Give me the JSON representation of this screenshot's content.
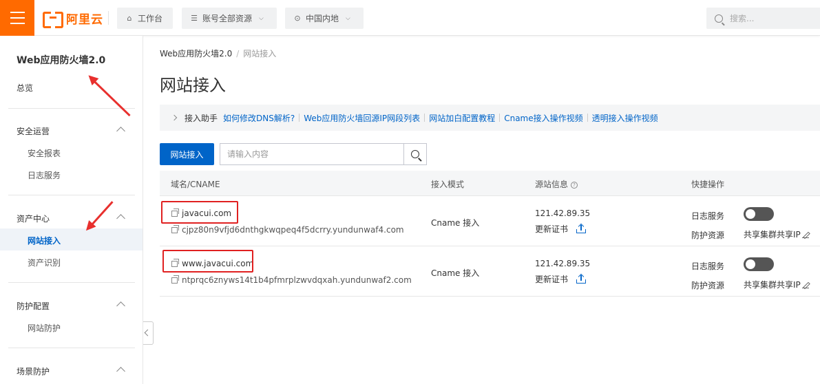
{
  "topbar": {
    "logo_text": "阿里云",
    "workbench": "工作台",
    "account_resources": "账号全部资源",
    "region": "中国内地",
    "search_placeholder": "搜索..."
  },
  "sidebar": {
    "title": "Web应用防火墙2.0",
    "overview": "总览",
    "groups": [
      {
        "label": "安全运营",
        "items": [
          "安全报表",
          "日志服务"
        ]
      },
      {
        "label": "资产中心",
        "items": [
          "网站接入",
          "资产识别"
        ]
      },
      {
        "label": "防护配置",
        "items": [
          "网站防护"
        ]
      },
      {
        "label": "场景防护",
        "items": []
      }
    ],
    "active_item": "网站接入"
  },
  "breadcrumb": {
    "parent": "Web应用防火墙2.0",
    "current": "网站接入"
  },
  "page_title": "网站接入",
  "helper": {
    "label": "接入助手",
    "links": [
      "如何修改DNS解析?",
      "Web应用防火墙回源IP网段列表",
      "网站加白配置教程",
      "Cname接入操作视频",
      "透明接入操作视频"
    ]
  },
  "toolbar": {
    "add_button": "网站接入",
    "search_placeholder": "请输入内容"
  },
  "table": {
    "columns": [
      "域名/CNAME",
      "接入模式",
      "源站信息",
      "快捷操作"
    ],
    "rows": [
      {
        "domain": "javacui.com",
        "cname": "cjpz80n9vfjd6dnthgkwqpeq4f5dcrry.yundunwaf4.com",
        "mode": "Cname 接入",
        "origin_ip": "121.42.89.35",
        "cert_action": "更新证书",
        "quick_log": "日志服务",
        "quick_protect": "防护资源",
        "log_toggle": "off",
        "shared_ip": "共享集群共享IP"
      },
      {
        "domain": "www.javacui.com",
        "cname": "ntprqc6znyws14t1b4pfmrplzwvdqxah.yundunwaf2.com",
        "mode": "Cname 接入",
        "origin_ip": "121.42.89.35",
        "cert_action": "更新证书",
        "quick_log": "日志服务",
        "quick_protect": "防护资源",
        "log_toggle": "off",
        "shared_ip": "共享集群共享IP"
      }
    ]
  },
  "colors": {
    "brand_orange": "#ff6a00",
    "primary_blue": "#0064c8",
    "highlight_red": "#e02020"
  }
}
